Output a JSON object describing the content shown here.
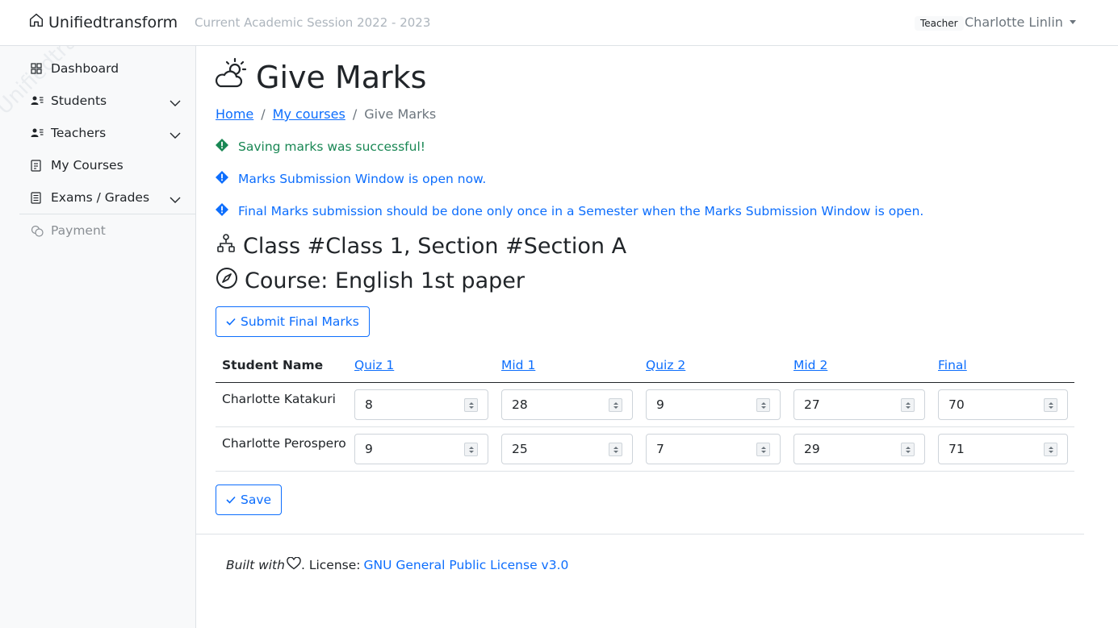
{
  "app": {
    "brand": "Unifiedtransform",
    "session": "Current Academic Session 2022 - 2023",
    "role_badge": "Teacher",
    "user_name": "Charlotte Linlin",
    "watermark": "Unifiedtransform"
  },
  "sidebar": {
    "items": [
      {
        "label": "Dashboard",
        "icon": "grid-icon"
      },
      {
        "label": "Students",
        "icon": "person-lines-icon",
        "expandable": true
      },
      {
        "label": "Teachers",
        "icon": "person-lines-icon",
        "expandable": true
      },
      {
        "label": "My Courses",
        "icon": "journal-icon"
      },
      {
        "label": "Exams / Grades",
        "icon": "file-text-icon",
        "expandable": true
      },
      {
        "label": "Payment",
        "icon": "coins-icon",
        "disabled": true
      }
    ]
  },
  "page": {
    "title": "Give Marks",
    "title_icon": "cloud-sun-icon",
    "breadcrumb": {
      "home": "Home",
      "my_courses": "My courses",
      "current": "Give Marks",
      "separator": "/"
    },
    "alerts": [
      {
        "type": "success",
        "text": "Saving marks was successful!"
      },
      {
        "type": "info",
        "text": "Marks Submission Window is open now."
      },
      {
        "type": "info",
        "text": "Final Marks submission should be done only once in a Semester when the Marks Submission Window is open."
      }
    ],
    "class_heading": "Class #Class 1, Section #Section A",
    "course_heading": "Course: English 1st paper",
    "submit_final_label": "Submit Final Marks",
    "save_label": "Save"
  },
  "table": {
    "name_header": "Student Name",
    "columns": [
      "Quiz 1",
      "Mid 1",
      "Quiz 2",
      "Mid 2",
      "Final"
    ],
    "rows": [
      {
        "name": "Charlotte Katakuri",
        "marks": [
          "8",
          "28",
          "9",
          "27",
          "70"
        ]
      },
      {
        "name": "Charlotte Perospero",
        "marks": [
          "9",
          "25",
          "7",
          "29",
          "71"
        ]
      }
    ]
  },
  "footer": {
    "built_with": "Built with",
    "license_prefix": ". License:",
    "license_link": "GNU General Public License v3.0"
  },
  "colors": {
    "primary": "#0d6efd",
    "success": "#198754",
    "muted": "#6c757d"
  }
}
